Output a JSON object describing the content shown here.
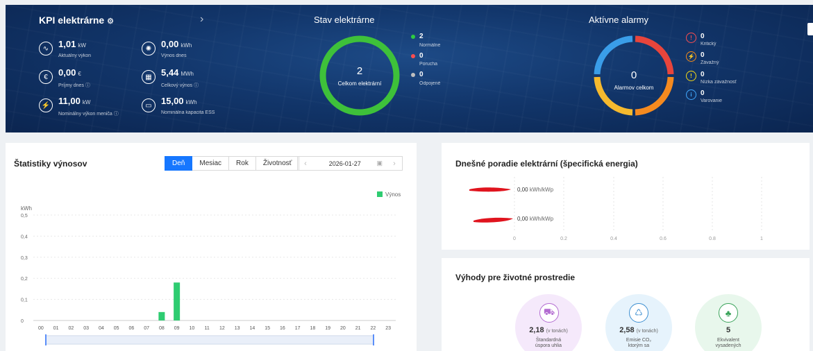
{
  "kpi": {
    "title": "KPI elektrárne",
    "items": [
      {
        "value": "1,01",
        "unit": "kW",
        "label": "Aktuálny výkon",
        "icon": "pulse-icon"
      },
      {
        "value": "0,00",
        "unit": "kWh",
        "label": "Výnos dnes",
        "icon": "solar-icon"
      },
      {
        "value": "0,00",
        "unit": "€",
        "label": "Príjmy dnes ⓘ",
        "icon": "money-icon"
      },
      {
        "value": "5,44",
        "unit": "MWh",
        "label": "Celkový výnos ⓘ",
        "icon": "panel-icon"
      },
      {
        "value": "11,00",
        "unit": "kW",
        "label": "Nominálny výkon meniča ⓘ",
        "icon": "inverter-icon"
      },
      {
        "value": "15,00",
        "unit": "kWh",
        "label": "Nominálna kapacita ESS",
        "icon": "battery-icon"
      }
    ]
  },
  "status": {
    "title": "Stav elektrárne",
    "total": "2",
    "total_label": "Celkom elektrární",
    "legend": [
      {
        "count": "2",
        "label": "Normálne",
        "color": "#2ecc40"
      },
      {
        "count": "0",
        "label": "Porucha",
        "color": "#ff4d4f"
      },
      {
        "count": "0",
        "label": "Odpojené",
        "color": "#bfbfbf"
      }
    ]
  },
  "alarms": {
    "title": "Aktívne alarmy",
    "total": "0",
    "total_label": "Alarmov celkom",
    "items": [
      {
        "count": "0",
        "label": "Kritický",
        "color": "#ff4d4f",
        "icon": "critical-icon"
      },
      {
        "count": "0",
        "label": "Závažný",
        "color": "#fa8c16",
        "icon": "major-icon"
      },
      {
        "count": "0",
        "label": "Nízka závažnosť",
        "color": "#fadb14",
        "icon": "minor-icon"
      },
      {
        "count": "0",
        "label": "Varovanie",
        "color": "#40a9ff",
        "icon": "info-icon"
      }
    ]
  },
  "yield": {
    "title": "Štatistiky výnosov",
    "tabs": [
      "Deň",
      "Mesiac",
      "Rok",
      "Životnosť"
    ],
    "date": "2026-01-27"
  },
  "chart_data": {
    "type": "bar",
    "ylabel": "kWh",
    "ylim": [
      0,
      0.5
    ],
    "yticks": [
      "0",
      "0,1",
      "0,2",
      "0,3",
      "0,4",
      "0,5"
    ],
    "categories": [
      "00",
      "01",
      "02",
      "03",
      "04",
      "05",
      "06",
      "07",
      "08",
      "09",
      "10",
      "11",
      "12",
      "13",
      "14",
      "15",
      "16",
      "17",
      "18",
      "19",
      "20",
      "21",
      "22",
      "23"
    ],
    "series": [
      {
        "name": "Výnos",
        "color": "#2ecc71",
        "values": [
          0,
          0,
          0,
          0,
          0,
          0,
          0,
          0,
          0.04,
          0.18,
          0,
          0,
          0,
          0,
          0,
          0,
          0,
          0,
          0,
          0,
          0,
          0,
          0,
          0
        ]
      }
    ],
    "legend": "top-right",
    "grid": true
  },
  "ranking": {
    "title": "Dnešné poradie elektrární (špecifická energia)",
    "rows": [
      {
        "value": "0,00",
        "unit": "kWh/kWp"
      },
      {
        "value": "0,00",
        "unit": "kWh/kWp"
      }
    ],
    "xticks": [
      "0",
      "0.2",
      "0.4",
      "0.6",
      "0.8",
      "1"
    ]
  },
  "env": {
    "title": "Výhody pre životné prostredie",
    "items": [
      {
        "value": "2,18",
        "unit": "(v tonách)",
        "label1": "Štandardná",
        "label2": "úspora uhlia",
        "icon": "coal-icon",
        "bg": "#f5e9fb",
        "fg": "#b36cd1"
      },
      {
        "value": "2,58",
        "unit": "(v tonách)",
        "label1": "Emisie CO₂",
        "label2": "ktorým sa",
        "icon": "co2-icon",
        "bg": "#e6f3fc",
        "fg": "#3d8fd1"
      },
      {
        "value": "5",
        "unit": "",
        "label1": "Ekvivalent",
        "label2": "vysadených",
        "icon": "tree-icon",
        "bg": "#e8f7ec",
        "fg": "#3aa35a"
      }
    ]
  }
}
